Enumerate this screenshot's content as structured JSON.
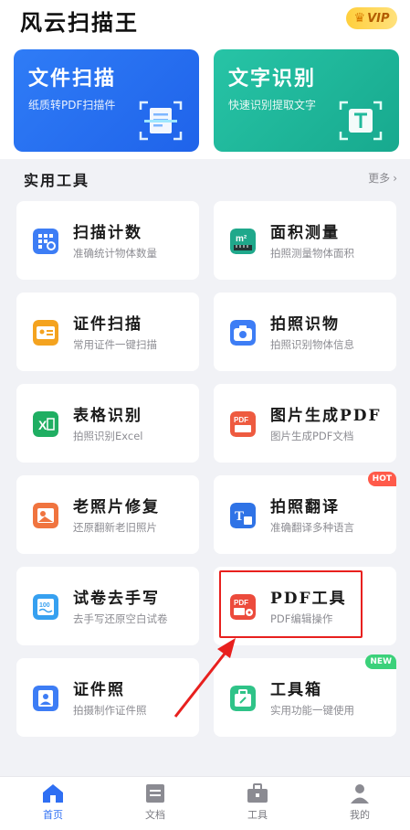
{
  "header": {
    "app_title": "风云扫描王",
    "vip_label": "VIP"
  },
  "hero_cards": [
    {
      "title": "文件扫描",
      "subtitle": "纸质转PDF扫描件",
      "color": "#2f7cf6"
    },
    {
      "title": "文字识别",
      "subtitle": "快速识别提取文字",
      "color": "#20b99b"
    }
  ],
  "tools_section": {
    "title": "实用工具",
    "more_label": "更多"
  },
  "tools": [
    {
      "name": "扫描计数",
      "desc": "准确统计物体数量",
      "icon": "grid-count-icon",
      "color": "#3d7df5"
    },
    {
      "name": "面积测量",
      "desc": "拍照测量物体面积",
      "icon": "area-measure-icon",
      "color": "#1fa88b"
    },
    {
      "name": "证件扫描",
      "desc": "常用证件一键扫描",
      "icon": "id-card-icon",
      "color": "#f4a31f"
    },
    {
      "name": "拍照识物",
      "desc": "拍照识别物体信息",
      "icon": "camera-icon",
      "color": "#3d7df5"
    },
    {
      "name": "表格识别",
      "desc": "拍照识别Excel",
      "icon": "excel-icon",
      "color": "#1fae62"
    },
    {
      "name": "图片生成PDF",
      "desc": "图片生成PDF文档",
      "icon": "pdf-image-icon",
      "color": "#ee5b40"
    },
    {
      "name": "老照片修复",
      "desc": "还原翻新老旧照片",
      "icon": "photo-restore-icon",
      "color": "#f0743f"
    },
    {
      "name": "拍照翻译",
      "desc": "准确翻译多种语言",
      "icon": "translate-icon",
      "color": "#2f73e6",
      "tag": "HOT"
    },
    {
      "name": "试卷去手写",
      "desc": "去手写还原空白试卷",
      "icon": "exam-paper-icon",
      "color": "#36a0f0"
    },
    {
      "name": "PDF工具",
      "desc": "PDF编辑操作",
      "icon": "pdf-tool-icon",
      "color": "#ec4b3c"
    },
    {
      "name": "证件照",
      "desc": "拍摄制作证件照",
      "icon": "id-photo-icon",
      "color": "#3d7df5"
    },
    {
      "name": "工具箱",
      "desc": "实用功能一键使用",
      "icon": "toolbox-icon",
      "color": "#2fc388",
      "tag": "NEW"
    }
  ],
  "tabbar": [
    {
      "label": "首页",
      "icon": "home-icon",
      "active": true
    },
    {
      "label": "文档",
      "icon": "document-icon",
      "active": false
    },
    {
      "label": "工具",
      "icon": "toolbox-tab-icon",
      "active": false
    },
    {
      "label": "我的",
      "icon": "profile-icon",
      "active": false
    }
  ],
  "colors": {
    "accent": "#2f6ff3",
    "highlight_box": "#e8201e"
  }
}
